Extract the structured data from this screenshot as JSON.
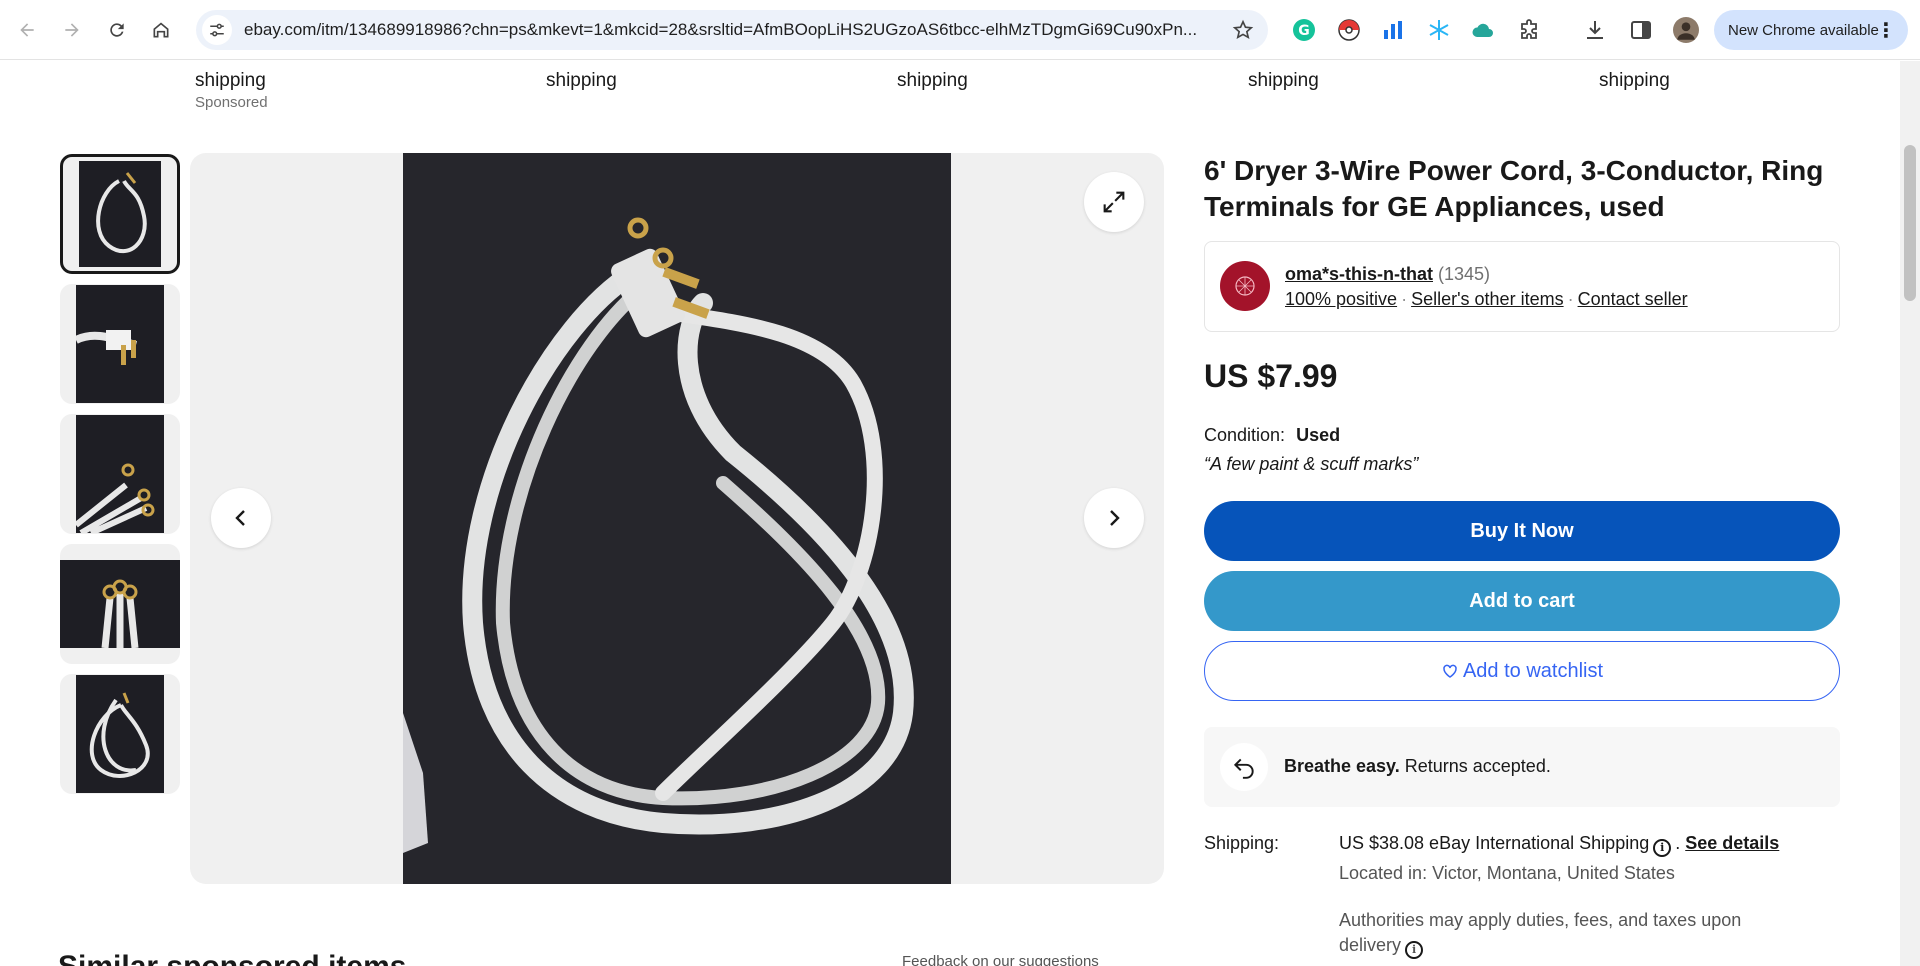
{
  "browser": {
    "url": "ebay.com/itm/134689918986?chn=ps&mkevt=1&mkcid=28&srsltid=AfmBOopLiHS2UGzoAS6tbcc-elhMzTDgmGi69Cu90xPn...",
    "update_label": "New Chrome available"
  },
  "strip": {
    "items": [
      {
        "ship": "shipping",
        "sponsored": "Sponsored"
      },
      {
        "ship": "shipping"
      },
      {
        "ship": "shipping"
      },
      {
        "ship": "shipping"
      },
      {
        "ship": "shipping"
      }
    ]
  },
  "product": {
    "title": "6' Dryer 3-Wire Power Cord, 3-Conductor, Ring Terminals for GE Appliances, used",
    "price": "US $7.99",
    "condition_label": "Condition:",
    "condition_value": "Used",
    "condition_note": "“A few paint & scuff marks”"
  },
  "seller": {
    "name": "oma*s-this-n-that",
    "feedback_count": "(1345)",
    "positive": "100% positive",
    "other_items": "Seller's other items",
    "contact": "Contact seller"
  },
  "actions": {
    "buy": "Buy It Now",
    "cart": "Add to cart",
    "watch": "Add to watchlist"
  },
  "returns": {
    "bold": "Breathe easy.",
    "rest": "Returns accepted."
  },
  "shipping": {
    "label": "Shipping:",
    "value": "US $38.08 eBay International Shipping",
    "details": "See details",
    "location": "Located in: Victor, Montana, United States",
    "duties": "Authorities may apply duties, fees, and taxes upon delivery"
  },
  "footer": {
    "similar": "Similar sponsored items",
    "feedback": "Feedback on our suggestions"
  },
  "colors": {
    "buy": "#0654ba",
    "cart": "#3498ca",
    "watch": "#3665f3"
  }
}
